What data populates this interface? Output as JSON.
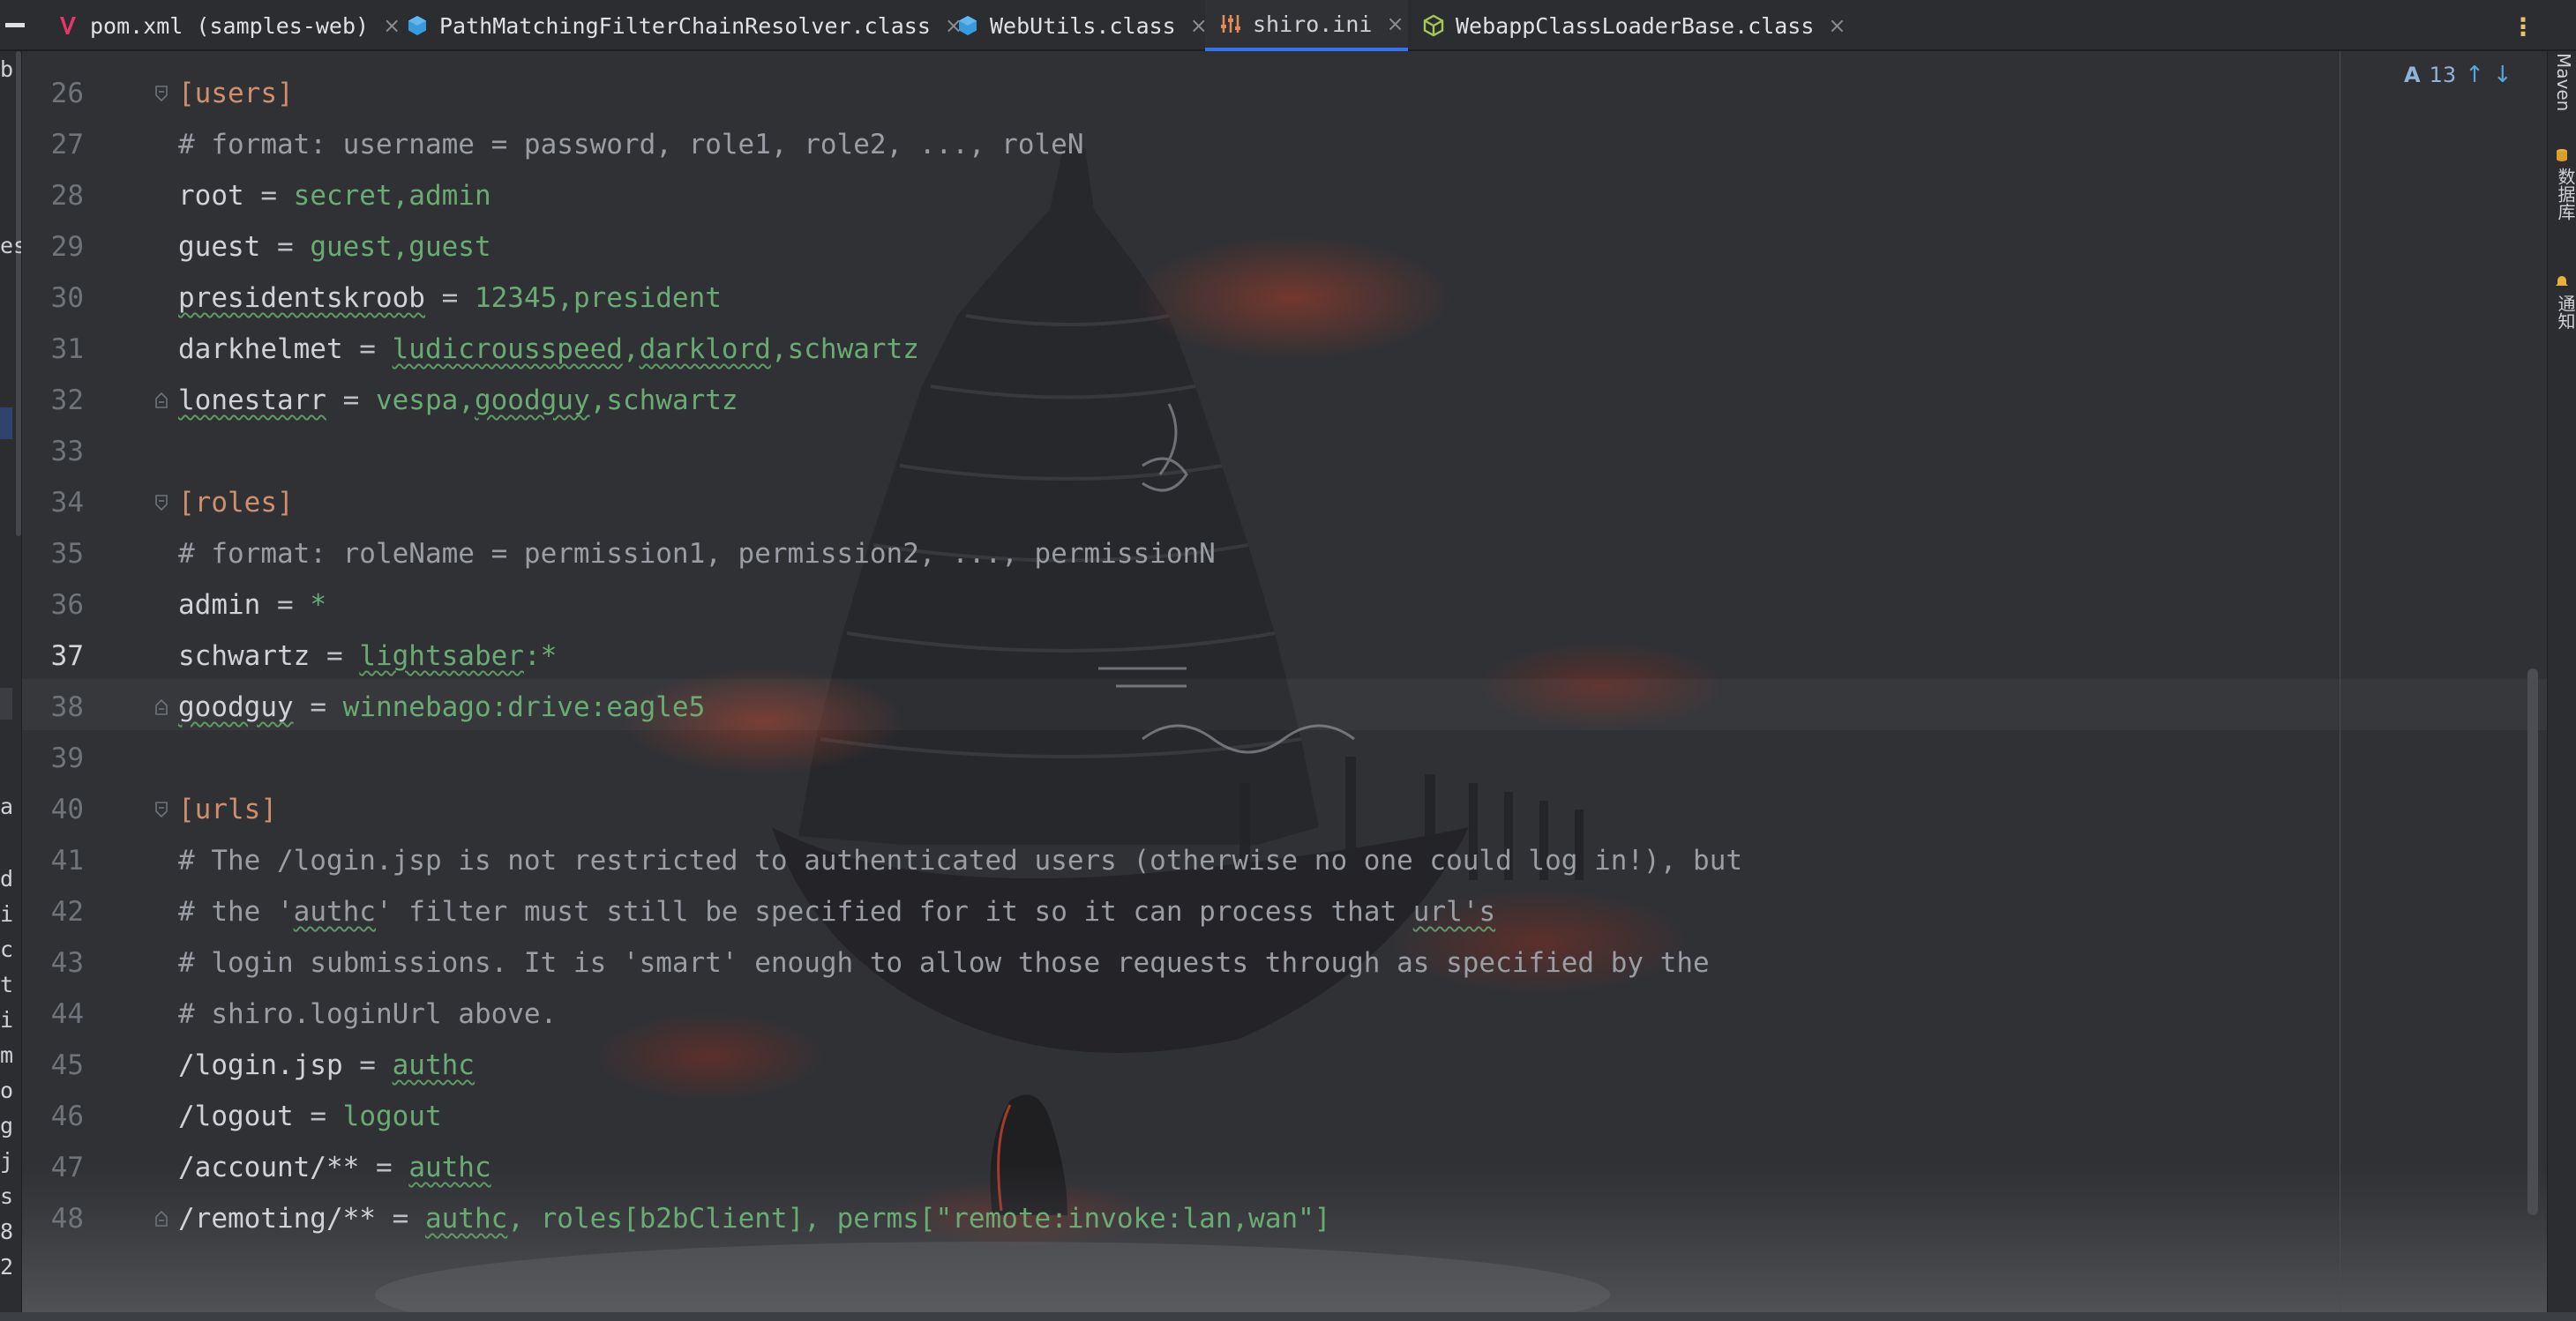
{
  "tabs": [
    {
      "label": "pom.xml (samples-web)",
      "icon": "maven-icon",
      "active": false
    },
    {
      "label": "PathMatchingFilterChainResolver.class",
      "icon": "class-file-icon",
      "active": false
    },
    {
      "label": "WebUtils.class",
      "icon": "class-file-icon",
      "active": false
    },
    {
      "label": "shiro.ini",
      "icon": "ini-file-icon",
      "active": true
    },
    {
      "label": "WebappClassLoaderBase.class",
      "icon": "java-class-icon",
      "active": false
    }
  ],
  "tab_close_glyph": "×",
  "more_tabs_glyph": "⋮",
  "left_strip": {
    "fragments": [
      "b",
      "es",
      "a",
      "d",
      "i",
      "c",
      "t",
      "i",
      "m",
      "o",
      "g",
      "j",
      "s",
      "8",
      "2"
    ]
  },
  "inspection": {
    "count": "13",
    "up_glyph": "↑",
    "down_glyph": "↓",
    "badge": "A"
  },
  "right_strip": {
    "maven": "Maven",
    "database": "数据库",
    "notifications": "通知"
  },
  "current_line": "37",
  "lines": [
    {
      "no": "26",
      "fold": "open",
      "segments": [
        {
          "t": "[users]",
          "c": "section"
        }
      ]
    },
    {
      "no": "27",
      "segments": [
        {
          "t": "# format: username = password, role1, role2, ..., roleN",
          "c": "comment"
        }
      ]
    },
    {
      "no": "28",
      "segments": [
        {
          "t": "root",
          "c": "key"
        },
        {
          "t": " = ",
          "c": "eq"
        },
        {
          "t": "secret,admin",
          "c": "val"
        }
      ]
    },
    {
      "no": "29",
      "segments": [
        {
          "t": "guest",
          "c": "key"
        },
        {
          "t": " = ",
          "c": "eq"
        },
        {
          "t": "guest,guest",
          "c": "val"
        }
      ]
    },
    {
      "no": "30",
      "segments": [
        {
          "t": "presidentskroob",
          "c": "key wavy-key"
        },
        {
          "t": " = ",
          "c": "eq"
        },
        {
          "t": "12345,president",
          "c": "val"
        }
      ]
    },
    {
      "no": "31",
      "segments": [
        {
          "t": "darkhelmet",
          "c": "key"
        },
        {
          "t": " = ",
          "c": "eq"
        },
        {
          "t": "ludicrousspeed",
          "c": "val wavy"
        },
        {
          "t": ",",
          "c": "val"
        },
        {
          "t": "darklord",
          "c": "val wavy"
        },
        {
          "t": ",schwartz",
          "c": "val"
        }
      ]
    },
    {
      "no": "32",
      "fold": "close",
      "segments": [
        {
          "t": "lonestarr",
          "c": "key wavy-key"
        },
        {
          "t": " = ",
          "c": "eq"
        },
        {
          "t": "vespa,",
          "c": "val"
        },
        {
          "t": "goodguy",
          "c": "val wavy"
        },
        {
          "t": ",schwartz",
          "c": "val"
        }
      ]
    },
    {
      "no": "33",
      "segments": []
    },
    {
      "no": "34",
      "fold": "open",
      "segments": [
        {
          "t": "[roles]",
          "c": "section"
        }
      ]
    },
    {
      "no": "35",
      "segments": [
        {
          "t": "# format: roleName = permission1, permission2, ..., permissionN",
          "c": "comment"
        }
      ]
    },
    {
      "no": "36",
      "segments": [
        {
          "t": "admin",
          "c": "key"
        },
        {
          "t": " = ",
          "c": "eq"
        },
        {
          "t": "*",
          "c": "val"
        }
      ]
    },
    {
      "no": "37",
      "segments": [
        {
          "t": "schwartz",
          "c": "key"
        },
        {
          "t": " = ",
          "c": "eq"
        },
        {
          "t": "lightsaber",
          "c": "val wavy"
        },
        {
          "t": ":*",
          "c": "val"
        }
      ]
    },
    {
      "no": "38",
      "fold": "close",
      "segments": [
        {
          "t": "goodguy",
          "c": "key wavy-key"
        },
        {
          "t": " = ",
          "c": "eq"
        },
        {
          "t": "winnebago:drive:eagle5",
          "c": "val"
        }
      ]
    },
    {
      "no": "39",
      "segments": []
    },
    {
      "no": "40",
      "fold": "open",
      "segments": [
        {
          "t": "[urls]",
          "c": "section"
        }
      ]
    },
    {
      "no": "41",
      "segments": [
        {
          "t": "# The /login.jsp is not restricted to authenticated users (otherwise no one could log in!), but",
          "c": "comment"
        }
      ]
    },
    {
      "no": "42",
      "segments": [
        {
          "t": "# the '",
          "c": "comment"
        },
        {
          "t": "authc",
          "c": "comment wavy"
        },
        {
          "t": "' filter must still be specified for it so it can process that ",
          "c": "comment"
        },
        {
          "t": "url's",
          "c": "comment wavy"
        }
      ]
    },
    {
      "no": "43",
      "segments": [
        {
          "t": "# login submissions. It is 'smart' enough to allow those requests through as specified by the",
          "c": "comment"
        }
      ]
    },
    {
      "no": "44",
      "segments": [
        {
          "t": "# shiro.loginUrl above.",
          "c": "comment"
        }
      ]
    },
    {
      "no": "45",
      "segments": [
        {
          "t": "/login.jsp",
          "c": "key"
        },
        {
          "t": " = ",
          "c": "eq"
        },
        {
          "t": "authc",
          "c": "val wavy"
        }
      ]
    },
    {
      "no": "46",
      "segments": [
        {
          "t": "/logout",
          "c": "key"
        },
        {
          "t": " = ",
          "c": "eq"
        },
        {
          "t": "logout",
          "c": "val"
        }
      ]
    },
    {
      "no": "47",
      "segments": [
        {
          "t": "/account/**",
          "c": "key"
        },
        {
          "t": " = ",
          "c": "eq"
        },
        {
          "t": "authc",
          "c": "val wavy"
        }
      ]
    },
    {
      "no": "48",
      "fold": "close",
      "segments": [
        {
          "t": "/remoting/**",
          "c": "key"
        },
        {
          "t": " = ",
          "c": "eq"
        },
        {
          "t": "authc",
          "c": "val wavy"
        },
        {
          "t": ", roles[b2bClient], perms[\"remote:invoke:lan,wan\"]",
          "c": "val"
        }
      ]
    }
  ]
}
